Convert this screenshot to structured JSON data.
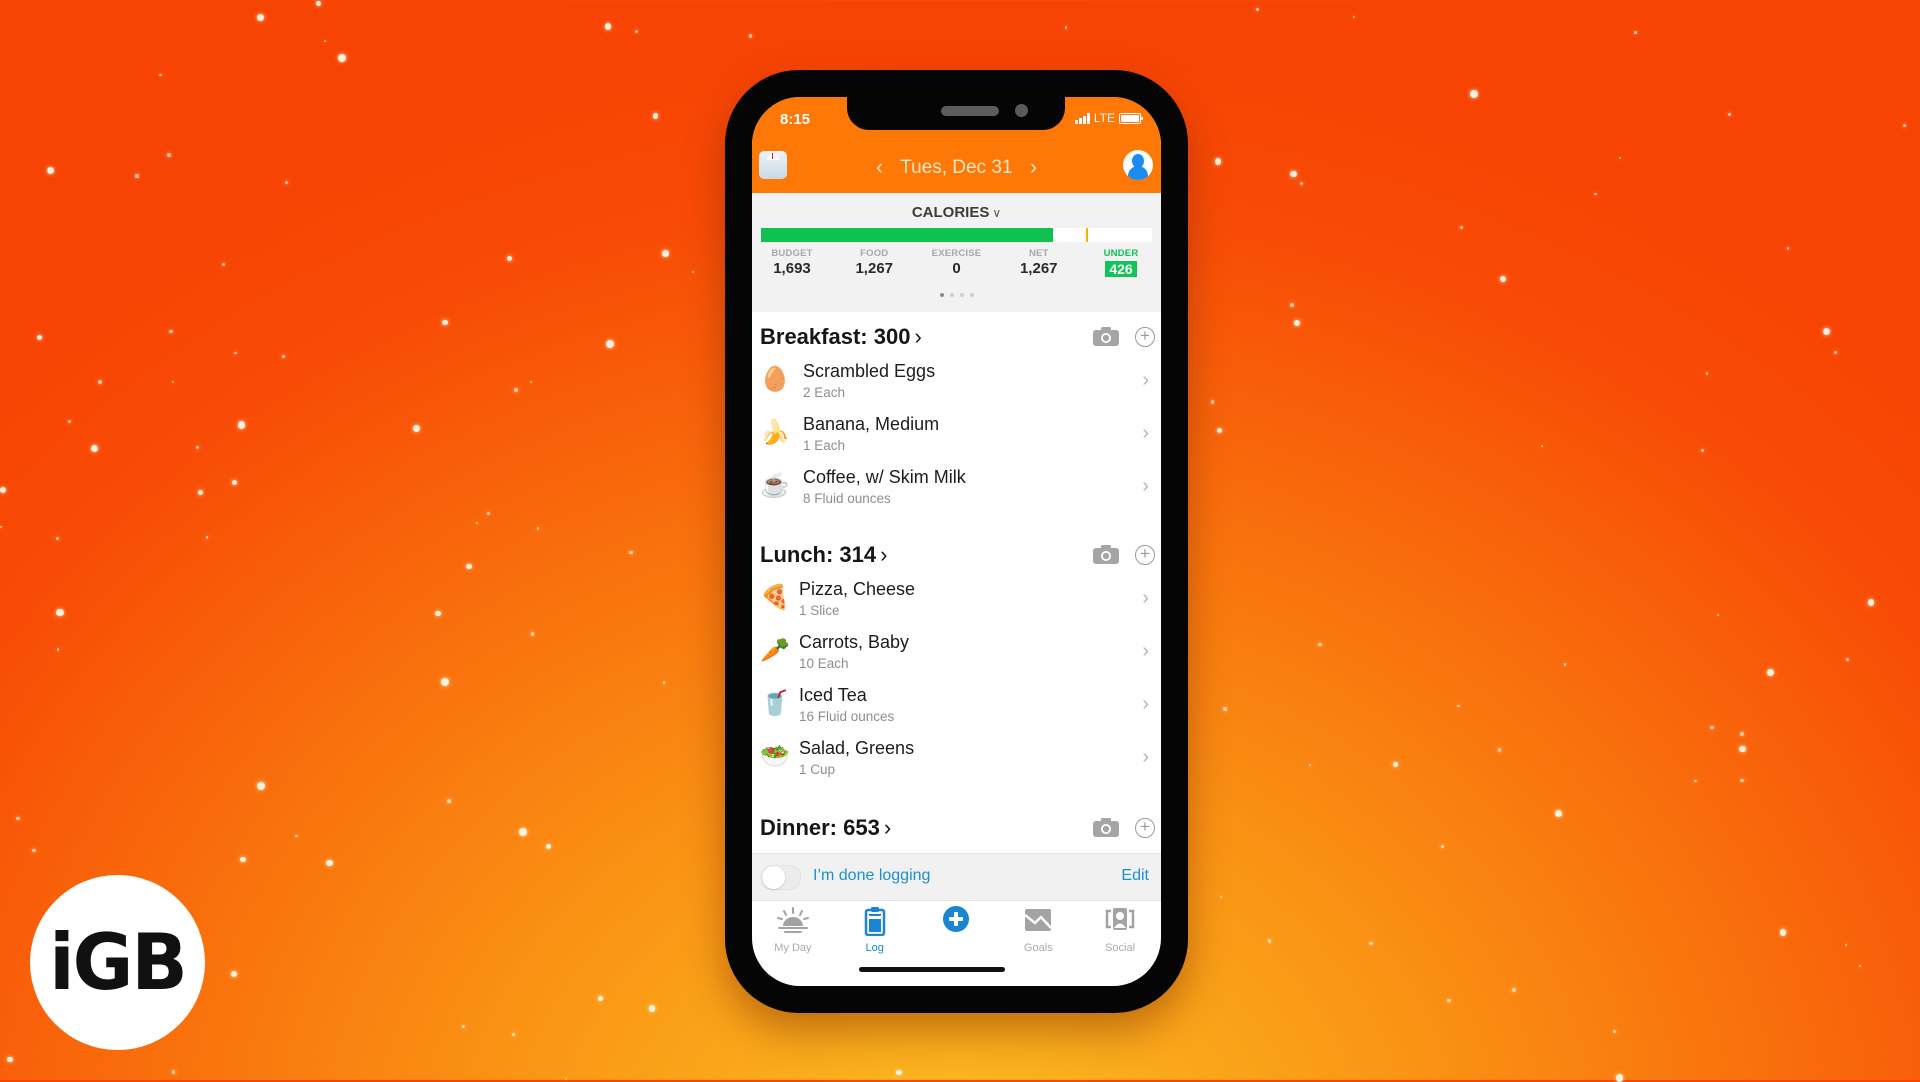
{
  "status_bar": {
    "time": "8:15",
    "network": "LTE"
  },
  "header": {
    "date": "Tues, Dec 31",
    "prev_icon": "chevron-left-icon",
    "next_icon": "chevron-right-icon",
    "left_icon": "weight-scale-icon",
    "right_icon": "profile-avatar-icon"
  },
  "calories": {
    "title": "CALORIES",
    "progress_fraction": 0.748,
    "marker_fraction": 0.83,
    "colors": {
      "fill": "#0fc24f",
      "marker": "#f4b400",
      "under_badge": "#12c35a"
    },
    "stats": [
      {
        "label": "BUDGET",
        "value": "1,693"
      },
      {
        "label": "FOOD",
        "value": "1,267"
      },
      {
        "label": "EXERCISE",
        "value": "0"
      },
      {
        "label": "NET",
        "value": "1,267"
      },
      {
        "label": "UNDER",
        "value": "426"
      }
    ],
    "page_dots": 4,
    "active_dot": 0
  },
  "meals": [
    {
      "title": "Breakfast: 300",
      "items": [
        {
          "name": "Scrambled Eggs",
          "qty": "2 Each",
          "icon": "egg-icon"
        },
        {
          "name": "Banana, Medium",
          "qty": "1 Each",
          "icon": "banana-icon"
        },
        {
          "name": "Coffee, w/ Skim Milk",
          "qty": "8 Fluid ounces",
          "icon": "coffee-cup-icon"
        }
      ]
    },
    {
      "title": "Lunch: 314",
      "items": [
        {
          "name": "Pizza, Cheese",
          "qty": "1 Slice",
          "icon": "pizza-icon"
        },
        {
          "name": "Carrots, Baby",
          "qty": "10 Each",
          "icon": "carrot-icon"
        },
        {
          "name": "Iced Tea",
          "qty": "16 Fluid ounces",
          "icon": "iced-tea-icon"
        },
        {
          "name": "Salad, Greens",
          "qty": "1 Cup",
          "icon": "salad-icon"
        }
      ]
    },
    {
      "title": "Dinner: 653",
      "items": []
    }
  ],
  "done_logging": {
    "label": "I’m done logging",
    "edit": "Edit",
    "toggled": false,
    "accent": "#1a8fd6"
  },
  "tabs": [
    {
      "label": "My Day",
      "icon": "sunrise-icon",
      "active": false
    },
    {
      "label": "Log",
      "icon": "clipboard-icon",
      "active": true
    },
    {
      "label": "",
      "icon": "add-circle-icon",
      "active": false
    },
    {
      "label": "Goals",
      "icon": "chart-down-icon",
      "active": false
    },
    {
      "label": "Social",
      "icon": "group-icon",
      "active": false
    }
  ],
  "brand": {
    "logo_text": "iGB",
    "header_color": "#fd7806"
  }
}
